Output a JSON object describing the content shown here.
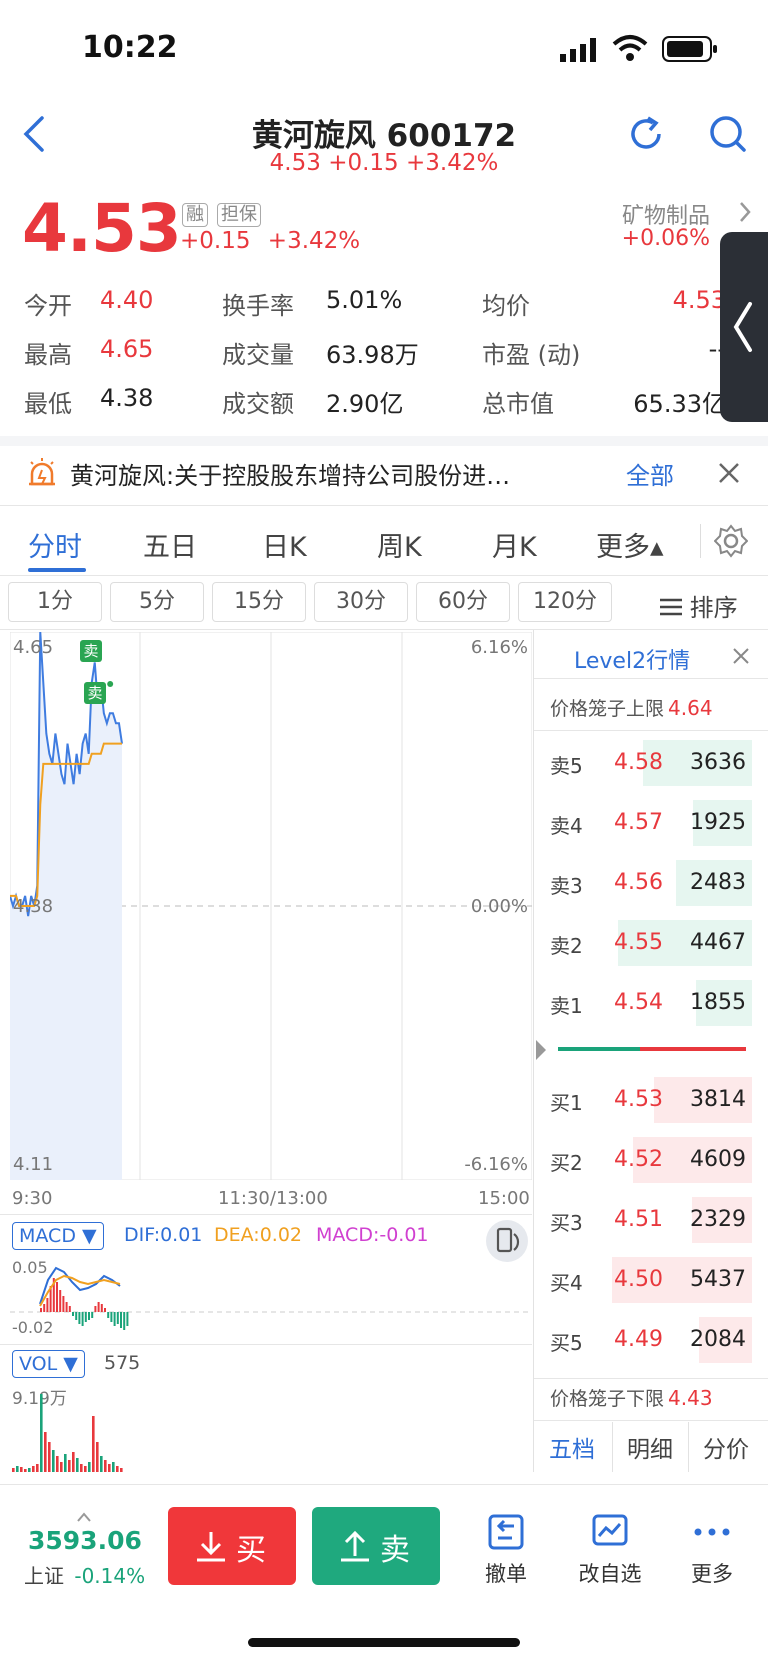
{
  "status": {
    "time": "10:22"
  },
  "header": {
    "title": "黄河旋风 600172",
    "subtitle": "4.53 +0.15 +3.42%"
  },
  "quote": {
    "price": "4.53",
    "tag_margin": "融",
    "tag_guarantee": "担保",
    "change": "+0.15",
    "change_pct": "+3.42%",
    "sector_name": "矿物制品",
    "sector_change": "+0.06%"
  },
  "stats": [
    [
      {
        "label": "今开",
        "value": "4.40",
        "color": "red"
      },
      {
        "label": "换手率",
        "value": "5.01%",
        "color": "black"
      },
      {
        "label": "均价",
        "value": "4.53",
        "color": "red"
      }
    ],
    [
      {
        "label": "最高",
        "value": "4.65",
        "color": "red"
      },
      {
        "label": "成交量",
        "value": "63.98万",
        "color": "black"
      },
      {
        "label": "市盈 (动)",
        "value": "--",
        "color": "black"
      }
    ],
    [
      {
        "label": "最低",
        "value": "4.38",
        "color": "black"
      },
      {
        "label": "成交额",
        "value": "2.90亿",
        "color": "black"
      },
      {
        "label": "总市值",
        "value": "65.33亿",
        "color": "black"
      }
    ]
  ],
  "news": {
    "text": "黄河旋风:关于控股股东增持公司股份进…",
    "all_label": "全部"
  },
  "tabs": [
    "分时",
    "五日",
    "日K",
    "周K",
    "月K",
    "更多▴"
  ],
  "periods": [
    "1分",
    "5分",
    "15分",
    "30分",
    "60分",
    "120分"
  ],
  "sort_label": "排序",
  "chart": {
    "y_top": "4.65",
    "y_mid": "4.38",
    "y_bot": "4.11",
    "pct_top": "6.16%",
    "pct_mid": "0.00%",
    "pct_bot": "-6.16%",
    "t_start": "9:30",
    "t_mid": "11:30/13:00",
    "t_end": "15:00",
    "sell_marker": "卖"
  },
  "chart_data": {
    "type": "line",
    "x_range": [
      "9:30",
      "15:00"
    ],
    "ylim": [
      4.11,
      4.65
    ],
    "prev_close": 4.38,
    "series": [
      {
        "values": [
          4.39,
          4.38,
          4.39,
          4.38,
          4.38,
          4.39,
          4.37,
          4.39,
          4.38,
          4.4,
          4.65,
          4.6,
          4.55,
          4.53,
          4.52,
          4.55,
          4.53,
          4.51,
          4.5,
          4.54,
          4.52,
          4.5,
          4.53,
          4.51,
          4.54,
          4.55,
          4.53,
          4.6,
          4.62,
          4.58,
          4.6,
          4.57,
          4.56,
          4.57,
          4.57,
          4.56,
          4.56,
          4.54
        ]
      },
      {
        "values": [
          4.39,
          4.39,
          4.39,
          4.38,
          4.38,
          4.38,
          4.38,
          4.38,
          4.38,
          4.39,
          4.48,
          4.52,
          4.52,
          4.52,
          4.52,
          4.52,
          4.52,
          4.52,
          4.52,
          4.52,
          4.52,
          4.52,
          4.52,
          4.52,
          4.52,
          4.52,
          4.52,
          4.53,
          4.53,
          4.53,
          4.53,
          4.54,
          4.54,
          4.54,
          4.54,
          4.54,
          4.54,
          4.54
        ]
      }
    ]
  },
  "macd": {
    "label": "MACD ▼",
    "dif": "DIF:0.01",
    "dea": "DEA:0.02",
    "macd": "MACD:-0.01",
    "y_top": "0.05",
    "y_bot": "-0.02"
  },
  "vol": {
    "label": "VOL ▼",
    "value": "575",
    "y_top": "9.19万"
  },
  "level2": {
    "title": "Level2行情",
    "cage_upper_label": "价格笼子上限",
    "cage_upper": "4.64",
    "cage_lower_label": "价格笼子下限",
    "cage_lower": "4.43",
    "asks": [
      {
        "label": "卖5",
        "price": "4.58",
        "vol": "3636",
        "bar": 0.78
      },
      {
        "label": "卖4",
        "price": "4.57",
        "vol": "1925",
        "bar": 0.42
      },
      {
        "label": "卖3",
        "price": "4.56",
        "vol": "2483",
        "bar": 0.54
      },
      {
        "label": "卖2",
        "price": "4.55",
        "vol": "4467",
        "bar": 0.96
      },
      {
        "label": "卖1",
        "price": "4.54",
        "vol": "1855",
        "bar": 0.4
      }
    ],
    "bids": [
      {
        "label": "买1",
        "price": "4.53",
        "vol": "3814",
        "bar": 0.7
      },
      {
        "label": "买2",
        "price": "4.52",
        "vol": "4609",
        "bar": 0.85
      },
      {
        "label": "买3",
        "price": "4.51",
        "vol": "2329",
        "bar": 0.43
      },
      {
        "label": "买4",
        "price": "4.50",
        "vol": "5437",
        "bar": 1.0
      },
      {
        "label": "买5",
        "price": "4.49",
        "vol": "2084",
        "bar": 0.38
      }
    ],
    "tabs": [
      "五档",
      "明细",
      "分价"
    ]
  },
  "bottom": {
    "index_value": "3593.06",
    "index_name": "上证",
    "index_change": "-0.14%",
    "buy_label": "买",
    "sell_label": "卖",
    "cancel_label": "撤单",
    "watchlist_label": "改自选",
    "more_label": "更多"
  }
}
